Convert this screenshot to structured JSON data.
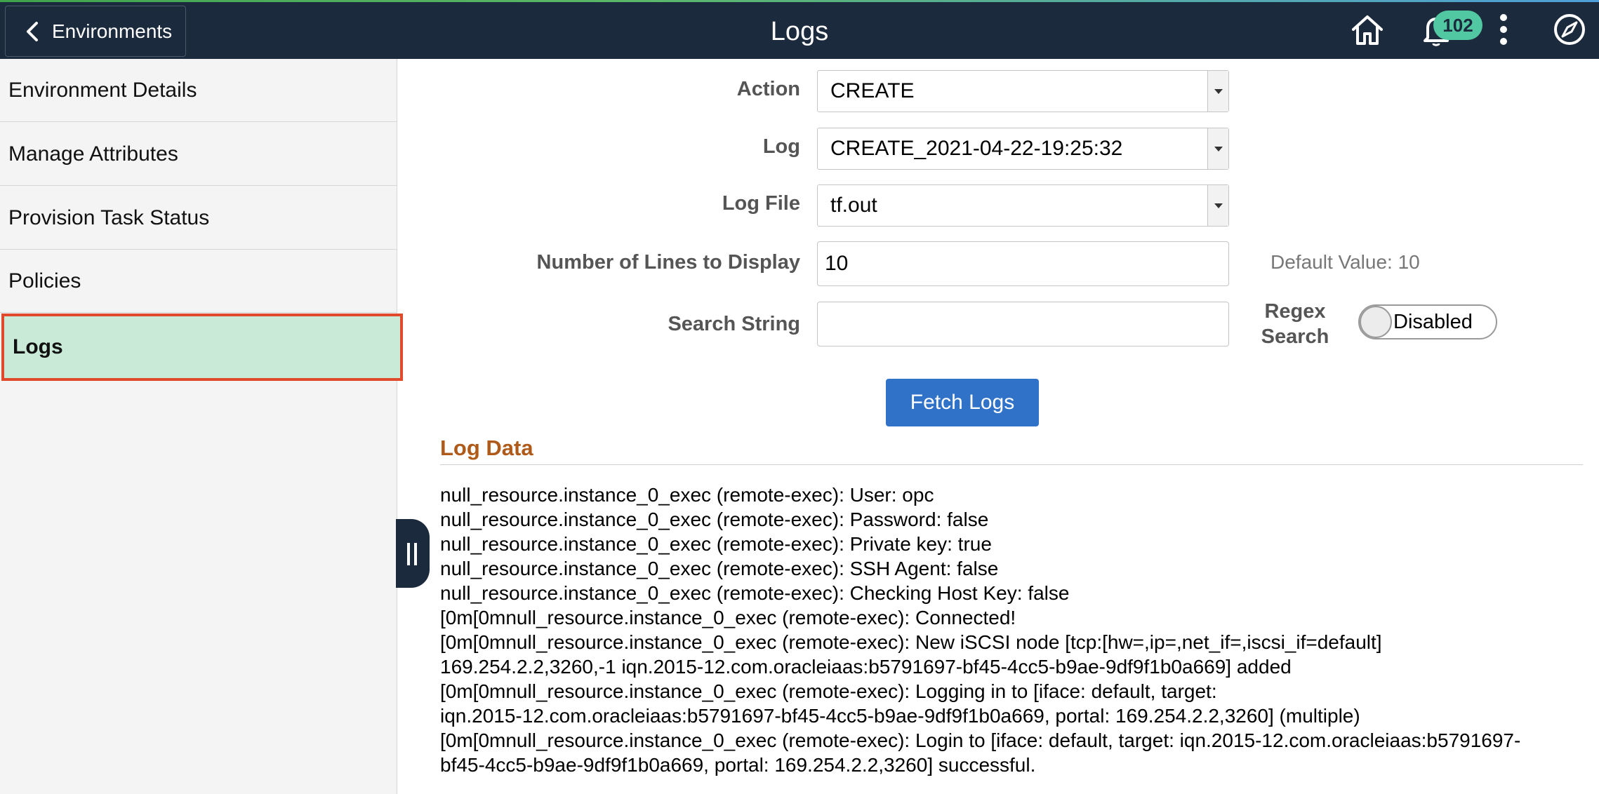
{
  "header": {
    "back_label": "Environments",
    "title": "Logs",
    "notification_count": "102",
    "icons": [
      "home-icon",
      "bell-icon",
      "more-vertical-icon",
      "compass-icon"
    ]
  },
  "sidebar": {
    "items": [
      {
        "label": "Environment Details",
        "active": false
      },
      {
        "label": "Manage Attributes",
        "active": false
      },
      {
        "label": "Provision Task Status",
        "active": false
      },
      {
        "label": "Policies",
        "active": false
      },
      {
        "label": "Logs",
        "active": true
      }
    ]
  },
  "form": {
    "action_label": "Action",
    "action_value": "CREATE",
    "log_label": "Log",
    "log_value": "CREATE_2021-04-22-19:25:32",
    "logfile_label": "Log File",
    "logfile_value": "tf.out",
    "lines_label": "Number of Lines to Display",
    "lines_value": "10",
    "lines_hint": "Default Value: 10",
    "search_label": "Search String",
    "search_value": "",
    "regex_label_1": "Regex",
    "regex_label_2": "Search",
    "regex_toggle": "Disabled",
    "fetch_label": "Fetch Logs"
  },
  "log_section": {
    "title": "Log Data",
    "text": "null_resource.instance_0_exec (remote-exec): User: opc\nnull_resource.instance_0_exec (remote-exec): Password: false\nnull_resource.instance_0_exec (remote-exec): Private key: true\nnull_resource.instance_0_exec (remote-exec): SSH Agent: false\nnull_resource.instance_0_exec (remote-exec): Checking Host Key: false\n[0m[0mnull_resource.instance_0_exec (remote-exec): Connected!\n[0m[0mnull_resource.instance_0_exec (remote-exec): New iSCSI node [tcp:[hw=,ip=,net_if=,iscsi_if=default]\n169.254.2.2,3260,-1 iqn.2015-12.com.oracleiaas:b5791697-bf45-4cc5-b9ae-9df9f1b0a669] added\n[0m[0mnull_resource.instance_0_exec (remote-exec): Logging in to [iface: default, target:\niqn.2015-12.com.oracleiaas:b5791697-bf45-4cc5-b9ae-9df9f1b0a669, portal: 169.254.2.2,3260] (multiple)\n[0m[0mnull_resource.instance_0_exec (remote-exec): Login to [iface: default, target: iqn.2015-12.com.oracleiaas:b5791697-\nbf45-4cc5-b9ae-9df9f1b0a669, portal: 169.254.2.2,3260] successful."
  },
  "colors": {
    "header_bg": "#1b2a3c",
    "active_item_bg": "#c9ead6",
    "active_item_border": "#e0492c",
    "primary_button": "#2f72c8",
    "section_title": "#b05a19",
    "badge_bg": "#52c8a2"
  }
}
